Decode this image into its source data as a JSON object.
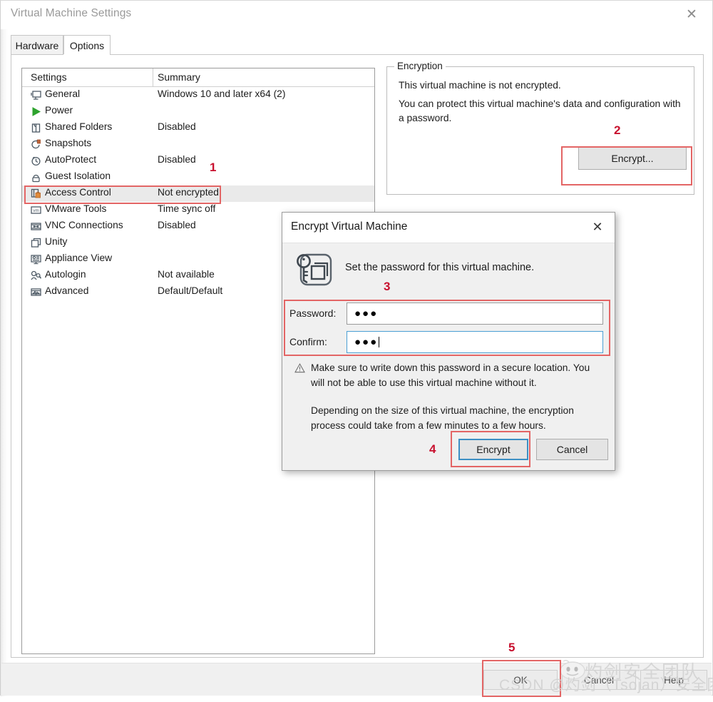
{
  "window": {
    "title": "Virtual Machine Settings",
    "close_label": "✕"
  },
  "tabs": [
    {
      "label": "Hardware",
      "active": false
    },
    {
      "label": "Options",
      "active": true
    }
  ],
  "settings_list": {
    "columns": [
      "Settings",
      "Summary"
    ],
    "rows": [
      {
        "icon": "monitor-icon",
        "label": "General",
        "summary": "Windows 10 and later x64 (2)"
      },
      {
        "icon": "play-icon",
        "label": "Power",
        "summary": ""
      },
      {
        "icon": "folder-icon",
        "label": "Shared Folders",
        "summary": "Disabled"
      },
      {
        "icon": "snapshot-icon",
        "label": "Snapshots",
        "summary": ""
      },
      {
        "icon": "clock-icon",
        "label": "AutoProtect",
        "summary": "Disabled"
      },
      {
        "icon": "lock-icon",
        "label": "Guest Isolation",
        "summary": ""
      },
      {
        "icon": "access-control-icon",
        "label": "Access Control",
        "summary": "Not encrypted",
        "selected": true
      },
      {
        "icon": "vmware-tools-icon",
        "label": "VMware Tools",
        "summary": "Time sync off"
      },
      {
        "icon": "vnc-icon",
        "label": "VNC Connections",
        "summary": "Disabled"
      },
      {
        "icon": "unity-icon",
        "label": "Unity",
        "summary": ""
      },
      {
        "icon": "appliance-icon",
        "label": "Appliance View",
        "summary": ""
      },
      {
        "icon": "autologin-icon",
        "label": "Autologin",
        "summary": "Not available"
      },
      {
        "icon": "advanced-icon",
        "label": "Advanced",
        "summary": "Default/Default"
      }
    ]
  },
  "encryption_group": {
    "legend": "Encryption",
    "line1": "This virtual machine is not encrypted.",
    "line2": "You can protect this virtual machine's data and configuration with a password.",
    "encrypt_button": "Encrypt..."
  },
  "dialog": {
    "title": "Encrypt Virtual Machine",
    "close_label": "✕",
    "heading": "Set the password for this virtual machine.",
    "icon": "key-vm-icon",
    "password_label": "Password:",
    "password_value": "●●●",
    "confirm_label": "Confirm:",
    "confirm_value": "●●●",
    "warning_icon": "warning-triangle-icon",
    "warning_line1": "Make sure to write down this password in a secure location. You will not be able to use this virtual machine without it.",
    "warning_line2": "Depending on the size of this virtual machine, the encryption process could take from a few minutes to a few hours.",
    "encrypt_button": "Encrypt",
    "cancel_button": "Cancel"
  },
  "footer": {
    "ok": "OK",
    "cancel": "Cancel",
    "help": "Help"
  },
  "annotations": {
    "n1": "1",
    "n2": "2",
    "n3": "3",
    "n4": "4",
    "n5": "5",
    "accent_color": "#c8102e",
    "box_color": "#e36565"
  },
  "watermark": {
    "logo_text": "灼剑安全团队",
    "credit_text": "CSDN @灼剑（Tsojan）安全团队"
  }
}
